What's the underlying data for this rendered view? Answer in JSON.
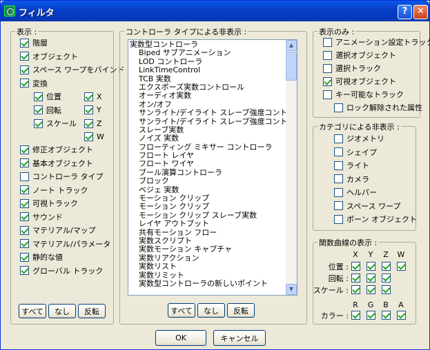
{
  "window": {
    "title": "フィルタ",
    "help": "?"
  },
  "show_group": {
    "title": "表示 :",
    "items": [
      {
        "label": "階層",
        "checked": true
      },
      {
        "label": "オブジェクト",
        "checked": true
      },
      {
        "label": "スペース ワープをバインド",
        "checked": true
      },
      {
        "label": "変換",
        "checked": true
      }
    ],
    "transform_items": [
      {
        "label": "位置",
        "checked": true
      },
      {
        "label": "回転",
        "checked": true
      },
      {
        "label": "スケール",
        "checked": true
      }
    ],
    "axes": [
      {
        "label": "X",
        "checked": true
      },
      {
        "label": "Y",
        "checked": true
      },
      {
        "label": "Z",
        "checked": true
      },
      {
        "label": "W",
        "checked": true
      }
    ],
    "items2": [
      {
        "label": "修正オブジェクト",
        "checked": true
      },
      {
        "label": "基本オブジェクト",
        "checked": true
      },
      {
        "label": "コントローラ タイプ",
        "checked": false
      },
      {
        "label": "ノート トラック",
        "checked": true
      },
      {
        "label": "可視トラック",
        "checked": true
      },
      {
        "label": "サウンド",
        "checked": true
      },
      {
        "label": "マテリアル/マップ",
        "checked": true
      },
      {
        "label": "マテリアル/パラメータ",
        "checked": true
      },
      {
        "label": "静的な値",
        "checked": true
      },
      {
        "label": "グローバル トラック",
        "checked": true
      }
    ],
    "buttons": {
      "all": "すべて",
      "none": "なし",
      "invert": "反転"
    }
  },
  "hide_by_controller": {
    "title": "コントローラ タイプによる非表示 :",
    "items": [
      "実数型コントローラ",
      "Biped サブアニメーション",
      "LOD コントローラ",
      "LinkTimeControl",
      "TCB 実数",
      "エクスポーズ実数コントロール",
      "オーディオ実数",
      "オン/オフ",
      "サンライト/デイライト スレーブ強度コントローラ",
      "サンライト/デイライト スレーブ強度コントローラ",
      "スレーブ実数",
      "ノイズ 実数",
      "フローティング ミキサー コントローラ",
      "フロート レイヤ",
      "フロート ワイヤ",
      "ブール演算コントローラ",
      "ブロック",
      "ベジェ 実数",
      "モーション クリップ",
      "モーション クリップ",
      "モーション クリップ スレーブ実数",
      "レイヤ アウトプット",
      "共有モーション フロー",
      "実数スクリプト",
      "実数モーション キャプチャ",
      "実数リアクション",
      "実数リスト",
      "実数リミット",
      "実数型コントローラの新しいポイント"
    ],
    "buttons": {
      "all": "すべて",
      "none": "なし",
      "invert": "反転"
    }
  },
  "show_only": {
    "title": "表示のみ :",
    "items": [
      {
        "label": "アニメーション設定トラック",
        "checked": false
      },
      {
        "label": "選択オブジェクト",
        "checked": false
      },
      {
        "label": "選択トラック",
        "checked": false
      },
      {
        "label": "可視オブジェクト",
        "checked": true
      },
      {
        "label": "キー可能なトラック",
        "checked": false
      }
    ],
    "sub_item": {
      "label": "ロック解除された属性",
      "checked": false
    }
  },
  "hide_by_category": {
    "title": "カテゴリによる非表示 :",
    "items": [
      {
        "label": "ジオメトリ",
        "checked": false
      },
      {
        "label": "シェイプ",
        "checked": false
      },
      {
        "label": "ライト",
        "checked": false
      },
      {
        "label": "カメラ",
        "checked": false
      },
      {
        "label": "ヘルパー",
        "checked": false
      },
      {
        "label": "スペース ワープ",
        "checked": false
      },
      {
        "label": "ボーン オブジェクト",
        "checked": false
      }
    ]
  },
  "function_curves": {
    "title": "関数曲線の表示 :",
    "columns": [
      "X",
      "Y",
      "Z",
      "W"
    ],
    "rows": [
      {
        "label": "位置 :",
        "checks": [
          true,
          true,
          true,
          true
        ]
      },
      {
        "label": "回転 :",
        "checks": [
          true,
          true,
          true
        ]
      },
      {
        "label": "スケール :",
        "checks": [
          true,
          true,
          true
        ]
      }
    ],
    "color_columns": [
      "R",
      "G",
      "B",
      "A"
    ],
    "color_row": {
      "label": "カラー :",
      "checks": [
        true,
        true,
        true,
        true
      ]
    }
  },
  "footer": {
    "ok": "OK",
    "cancel": "キャンセル"
  },
  "colors": {
    "titlebar": "#0840c8",
    "dialog_bg": "#ece9d8",
    "check": "#21a121"
  }
}
